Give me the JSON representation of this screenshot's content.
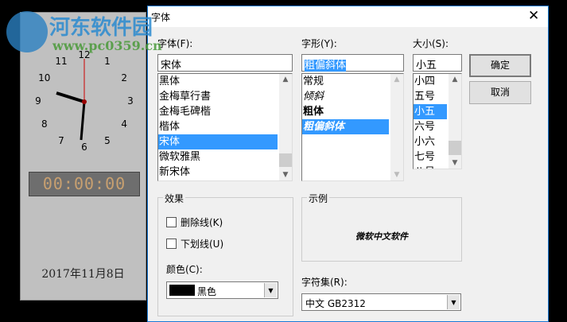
{
  "clock_window": {
    "numbers": [
      "12",
      "1",
      "2",
      "3",
      "4",
      "5",
      "6",
      "7",
      "8",
      "9",
      "10",
      "11"
    ],
    "digital_time": "00:00:00",
    "date": "2017年11月8日"
  },
  "watermark": {
    "name": "河东软件园",
    "url": "www.pc0359.cn"
  },
  "dialog": {
    "title": "字体",
    "font": {
      "label": "字体(F):",
      "value": "宋体",
      "items": [
        "黑体",
        "金梅草行書",
        "金梅毛碑楷",
        "楷体",
        "宋体",
        "微软雅黑",
        "新宋体"
      ],
      "selected": 4
    },
    "style": {
      "label": "字形(Y):",
      "value": "粗偏斜体",
      "items": [
        "常规",
        "倾斜",
        "粗体",
        "粗偏斜体"
      ],
      "selected": 3
    },
    "size": {
      "label": "大小(S):",
      "value": "小五",
      "items": [
        "小四",
        "五号",
        "小五",
        "六号",
        "小六",
        "七号",
        "八号"
      ],
      "selected": 2
    },
    "ok": "确定",
    "cancel": "取消",
    "effects": {
      "label": "效果",
      "strikeout": "删除线(K)",
      "underline": "下划线(U)",
      "color_label": "颜色(C):",
      "color_value": "黑色",
      "color_swatch": "#000000"
    },
    "sample": {
      "label": "示例",
      "text": "微软中文软件"
    },
    "charset": {
      "label": "字符集(R):",
      "value": "中文 GB2312"
    }
  }
}
